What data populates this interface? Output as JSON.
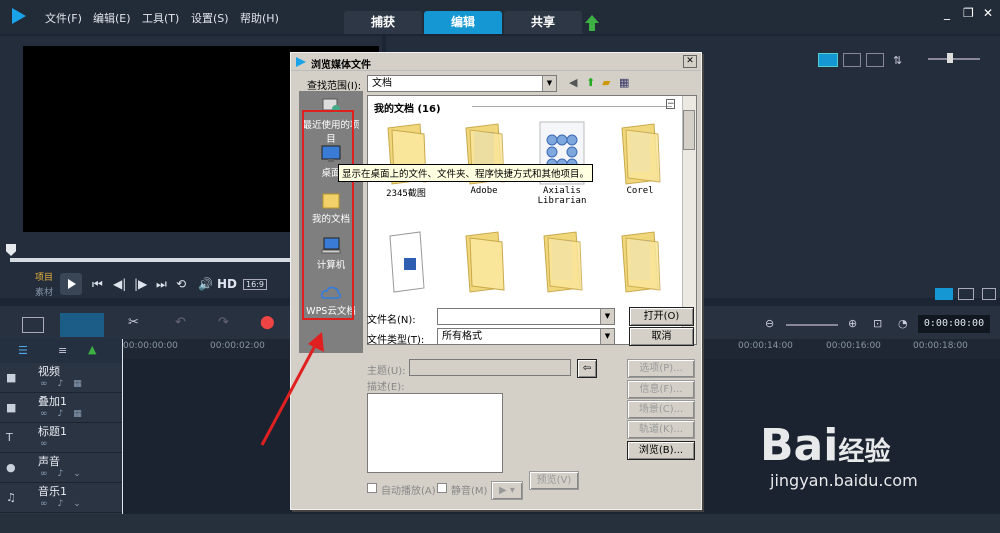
{
  "menubar": {
    "items": [
      "文件(F)",
      "编辑(E)",
      "工具(T)",
      "设置(S)",
      "帮助(H)"
    ],
    "tabs": [
      {
        "label": "捕获",
        "active": false
      },
      {
        "label": "编辑",
        "active": true
      },
      {
        "label": "共享",
        "active": false
      }
    ]
  },
  "preview": {
    "mode_project": "项目",
    "mode_clip": "素材",
    "hd_label": "HD",
    "ratio_label": "16:9"
  },
  "timeline": {
    "ruler": [
      "00:00:00:00",
      "00:00:02:00",
      "00:00:14:00",
      "00:00:16:00",
      "00:00:18:00"
    ],
    "timecode": "0:00:00:00",
    "tracks": [
      "视频",
      "叠加1",
      "标题1",
      "声音",
      "音乐1"
    ]
  },
  "dialog": {
    "title": "浏览媒体文件",
    "lookin_label": "查找范围(I):",
    "lookin_value": "文档",
    "places": [
      "最近使用的项目",
      "桌面",
      "我的文档",
      "计算机",
      "WPS云文档"
    ],
    "list_header": "我的文档 (16)",
    "files": [
      "2345截图",
      "Adobe",
      "Axialis Librarian",
      "Corel",
      "",
      "",
      "",
      ""
    ],
    "filename_label": "文件名(N):",
    "filename_value": "",
    "filetype_label": "文件类型(T):",
    "filetype_value": "所有格式",
    "open_button": "打开(O)",
    "cancel_button": "取消",
    "subject_label": "主题(U):",
    "desc_label": "描述(E):",
    "options_button": "选项(P)...",
    "info_button": "信息(F)...",
    "scene_button": "场景(C)...",
    "tags_button": "轨道(K)...",
    "browse_button": "浏览(B)...",
    "autoplay_label": "自动播放(A)",
    "mute_label": "静音(M)",
    "preview_button": "预览(V)"
  },
  "tooltip": "显示在桌面上的文件、文件夹、程序快捷方式和其他项目。",
  "watermark": {
    "brand": "Bai",
    "brand2": "经验",
    "url": "jingyan.baidu.com"
  },
  "colors": {
    "accent": "#1597d4",
    "highlight": "#e02020"
  }
}
